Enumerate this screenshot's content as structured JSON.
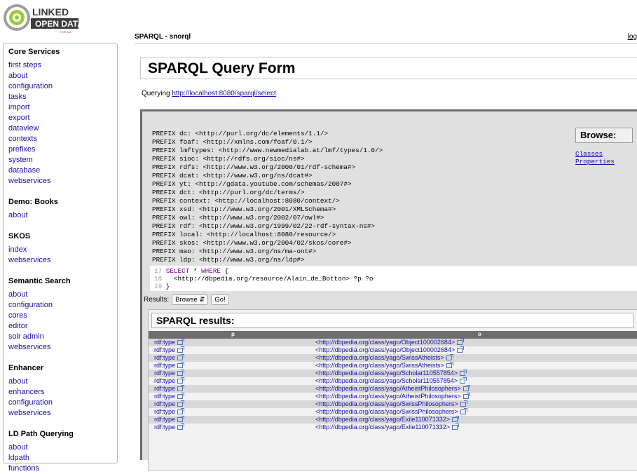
{
  "logo": {
    "line1": "LINKED",
    "line2": "OPEN DATA",
    "tag": "FOR ALL"
  },
  "header": {
    "title": "SPARQL - snorql",
    "logout": "log"
  },
  "sidebar": {
    "sections": [
      {
        "title": "Core Services",
        "links": [
          "first steps",
          "about",
          "configuration",
          "tasks",
          "import",
          "export",
          "dataview",
          "contexts",
          "prefixes",
          "system",
          "database",
          "webservices"
        ]
      },
      {
        "title": "Demo: Books",
        "links": [
          "about"
        ]
      },
      {
        "title": "SKOS",
        "links": [
          "index",
          "webservices"
        ]
      },
      {
        "title": "Semantic Search",
        "links": [
          "about",
          "configuration",
          "cores",
          "editor",
          "solr admin",
          "webservices"
        ]
      },
      {
        "title": "Enhancer",
        "links": [
          "about",
          "enhancers",
          "configuration",
          "webservices"
        ]
      },
      {
        "title": "LD Path Querying",
        "links": [
          "about",
          "ldpath",
          "functions"
        ]
      }
    ]
  },
  "main": {
    "title": "SPARQL Query Form",
    "querying_label": "Querying ",
    "endpoint": "http://localhost:8080/sparql/select",
    "prefixes": [
      "PREFIX dc: <http://purl.org/dc/elements/1.1/>",
      "PREFIX foaf: <http://xmlns.com/foaf/0.1/>",
      "PREFIX lmftypes: <http://www.newmedialab.at/lmf/types/1.0/>",
      "PREFIX sioc: <http://rdfs.org/sioc/ns#>",
      "PREFIX rdfs: <http://www.w3.org/2000/01/rdf-schema#>",
      "PREFIX dcat: <http://www.w3.org/ns/dcat#>",
      "PREFIX yt: <http://gdata.youtube.com/schemas/2007#>",
      "PREFIX dct: <http://purl.org/dc/terms/>",
      "PREFIX context: <http://localhost:8080/context/>",
      "PREFIX xsd: <http://www.w3.org/2001/XMLSchema#>",
      "PREFIX owl: <http://www.w3.org/2002/07/owl#>",
      "PREFIX rdf: <http://www.w3.org/1999/02/22-rdf-syntax-ns#>",
      "PREFIX local: <http://localhost:8080/resource/>",
      "PREFIX skos: <http://www.w3.org/2004/02/skos/core#>",
      "PREFIX mao: <http://www.w3.org/ns/ma-ont#>",
      "PREFIX ldp: <http://www.w3.org/ns/ldp#>"
    ],
    "browse": {
      "title": "Browse:",
      "links": [
        "Classes",
        "Properties"
      ]
    },
    "editor": {
      "lines": [
        {
          "num": "17",
          "kw": "SELECT",
          "rest": " * ",
          "kw2": "WHERE",
          "tail": " {"
        },
        {
          "num": "18",
          "kw": "",
          "rest": "  <http://dbpedia.org/resource/Alain_de_Botton> ?p ?o",
          "kw2": "",
          "tail": ""
        },
        {
          "num": "19",
          "kw": "",
          "rest": "}",
          "kw2": "",
          "tail": ""
        }
      ]
    },
    "results_label": "Results:",
    "results_select": "Browse",
    "go_button": "Go!",
    "results": {
      "title": "SPARQL results:",
      "columns": [
        "p",
        "o"
      ],
      "rows": [
        [
          "rdf:type",
          "<http://dbpedia.org/class/yago/Object100002684>"
        ],
        [
          "rdf:type",
          "<http://dbpedia.org/class/yago/Object100002684>"
        ],
        [
          "rdf:type",
          "<http://dbpedia.org/class/yago/SwissAtheists>"
        ],
        [
          "rdf:type",
          "<http://dbpedia.org/class/yago/SwissAtheists>"
        ],
        [
          "rdf:type",
          "<http://dbpedia.org/class/yago/Scholar110557854>"
        ],
        [
          "rdf:type",
          "<http://dbpedia.org/class/yago/Scholar110557854>"
        ],
        [
          "rdf:type",
          "<http://dbpedia.org/class/yago/AtheistPhilosophers>"
        ],
        [
          "rdf:type",
          "<http://dbpedia.org/class/yago/AtheistPhilosophers>"
        ],
        [
          "rdf:type",
          "<http://dbpedia.org/class/yago/SwissPhilosophers>"
        ],
        [
          "rdf:type",
          "<http://dbpedia.org/class/yago/SwissPhilosophers>"
        ],
        [
          "rdf:type",
          "<http://dbpedia.org/class/yago/Exile110071332>"
        ],
        [
          "rdf:type",
          "<http://dbpedia.org/class/yago/Exile110071332>"
        ]
      ]
    }
  }
}
